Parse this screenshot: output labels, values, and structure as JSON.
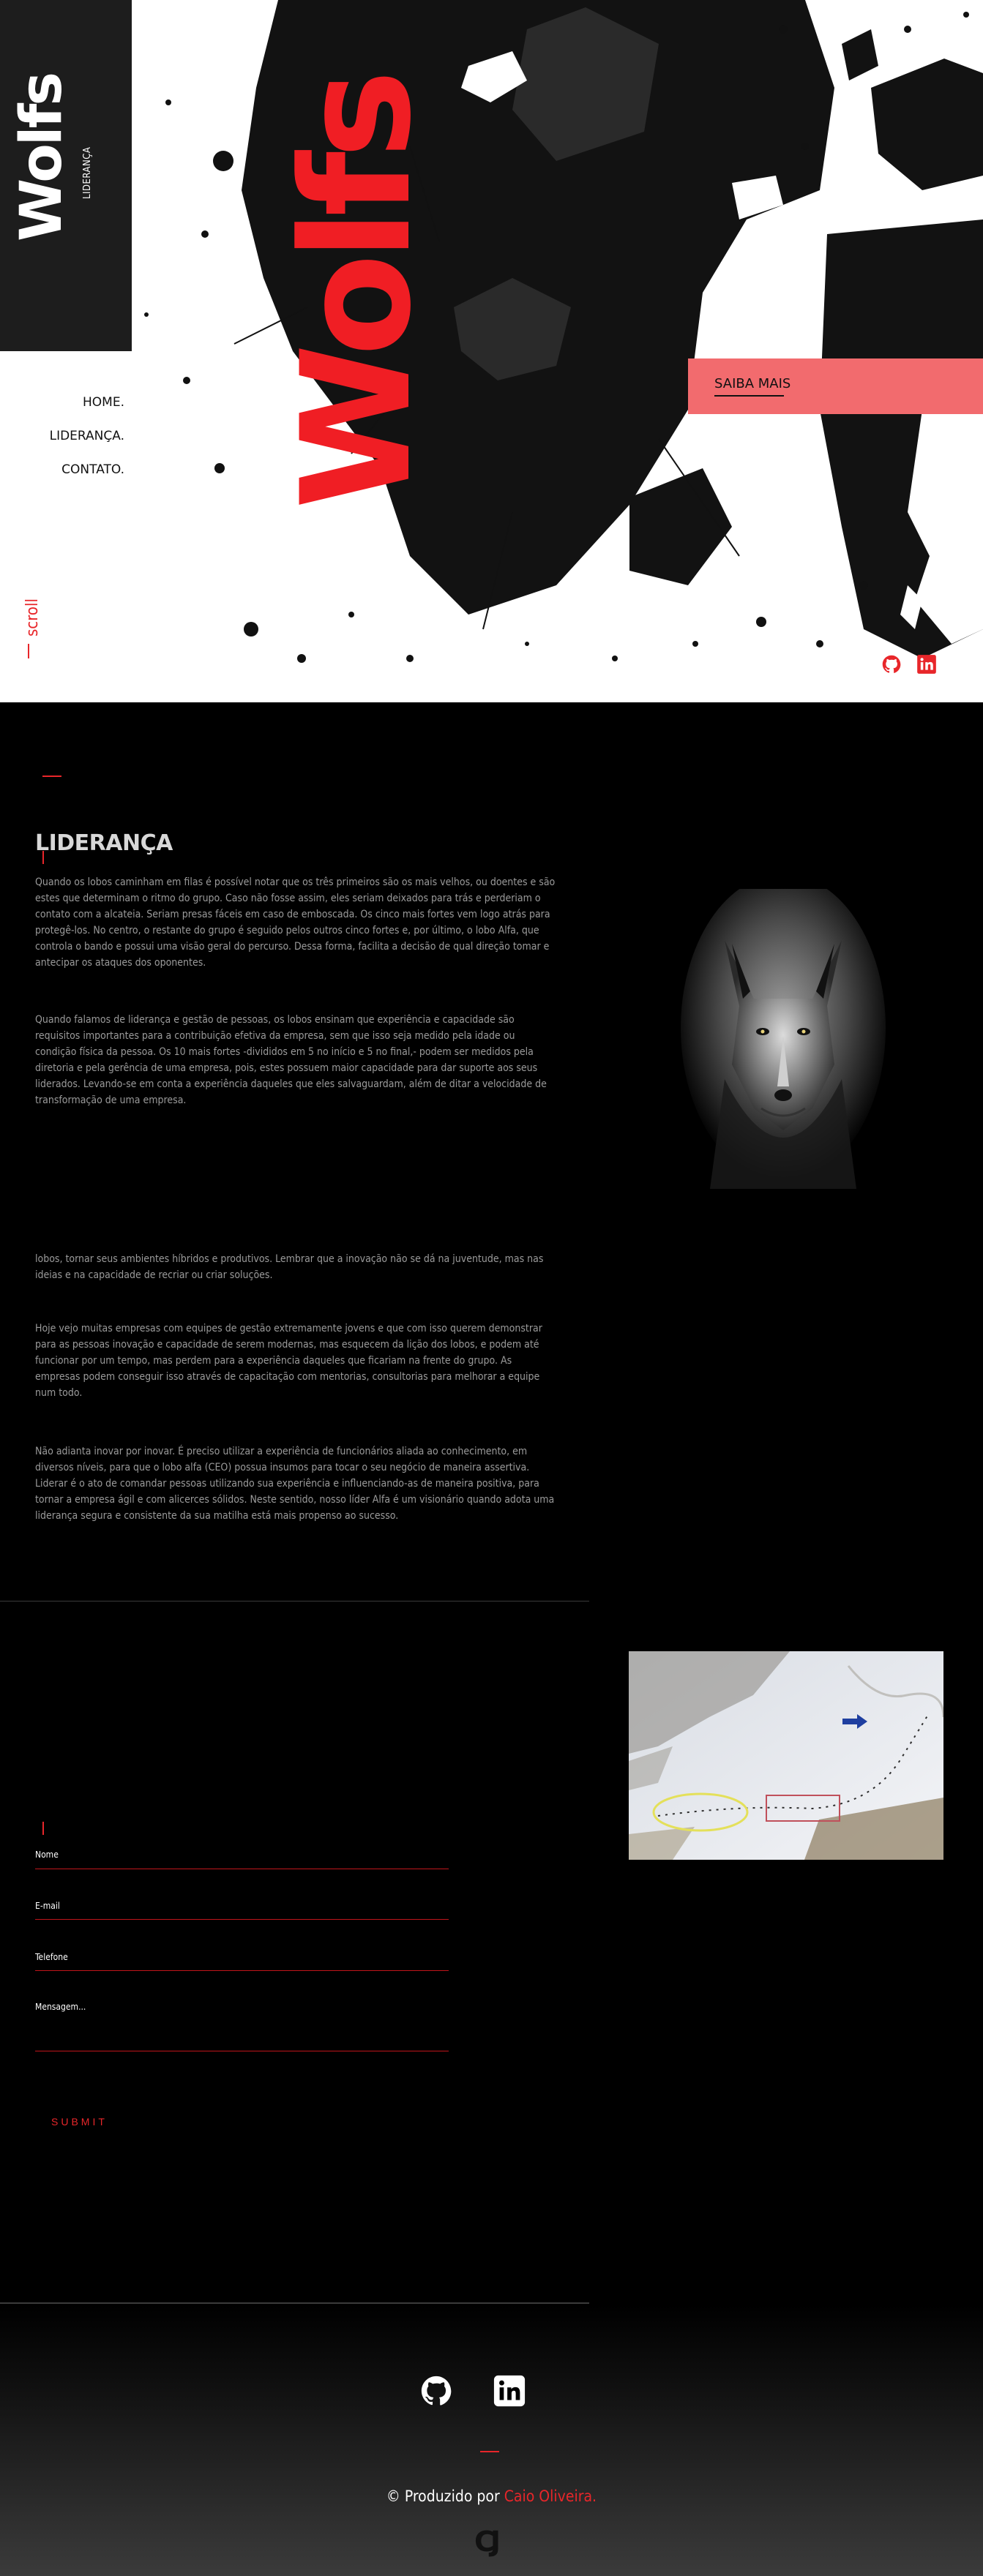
{
  "hero": {
    "brand": "Wolfs",
    "brand_sub": "LIDERANÇA",
    "nav": [
      "HOME.",
      "LIDERANÇA.",
      "CONTATO."
    ],
    "scroll_label": "scroll",
    "big_title": "Wolfs",
    "cta_label": "SAIBA MAIS",
    "social_icons": [
      "github-icon",
      "linkedin-icon"
    ],
    "accent_color": "#f01e24"
  },
  "about": {
    "title": "LIDERANÇA",
    "paragraphs": [
      "Quando os lobos caminham em filas é possível notar que os três primeiros são os mais velhos, ou doentes e são estes que determinam o ritmo do grupo. Caso não fosse assim, eles seriam deixados para trás e perderiam o contato com a alcateia. Seriam presas fáceis em caso de emboscada. Os cinco mais fortes vem logo atrás para protegê-los. No centro, o restante do grupo é seguido pelos outros cinco fortes e, por último, o lobo Alfa, que controla o bando e possui uma visão geral do percurso. Dessa forma, facilita a decisão de qual direção tomar e antecipar os ataques dos oponentes.",
      "Quando falamos de liderança e gestão de pessoas, os lobos ensinam que experiência e capacidade são requisitos importantes para a contribuição efetiva da empresa, sem que isso seja medido pela idade ou condição física da pessoa. Os 10 mais fortes -divididos em 5 no início e 5 no final,- podem ser medidos pela diretoria e pela gerência de uma empresa, pois, estes possuem maior capacidade para dar suporte aos seus liderados. Levando-se em conta a experiência daqueles que eles salvaguardam, além de ditar a velocidade de transformação de uma empresa.",
      "lobos, tornar seus ambientes híbridos e produtivos. Lembrar que a inovação não se dá na juventude, mas nas ideias e na capacidade de recriar ou criar soluções.",
      "Hoje vejo muitas empresas com equipes de gestão extremamente jovens e que com isso querem demonstrar para as pessoas inovação e capacidade de serem modernas, mas esquecem da lição dos lobos, e podem até funcionar por um tempo, mas perdem para a experiência daqueles que ficariam na frente do grupo. As empresas podem conseguir isso através de capacitação com mentorias, consultorias para melhorar a equipe num todo.",
      "Não adianta inovar por inovar. É preciso utilizar a experiência de funcionários aliada ao conhecimento, em diversos níveis, para que o lobo alfa (CEO) possua insumos para tocar o seu negócio de maneira assertiva. Liderar é o ato de comandar pessoas utilizando sua experiência e influenciando-as de maneira positiva, para tornar a empresa ágil e com alicerces sólidos. Neste sentido, nosso líder Alfa é um visionário quando adota uma liderança segura e consistente da sua matilha está mais propenso ao sucesso."
    ]
  },
  "contact": {
    "fields": [
      {
        "label": "Nome"
      },
      {
        "label": "E-mail"
      },
      {
        "label": "Telefone"
      },
      {
        "label": "Mensagem..."
      }
    ],
    "submit": "SUBMIT"
  },
  "footer": {
    "icons": [
      "github-icon",
      "linkedin-icon"
    ],
    "credit_prefix": "© Produzido por",
    "credit_name": "Caio Oliveira.",
    "logo": "CJ"
  }
}
